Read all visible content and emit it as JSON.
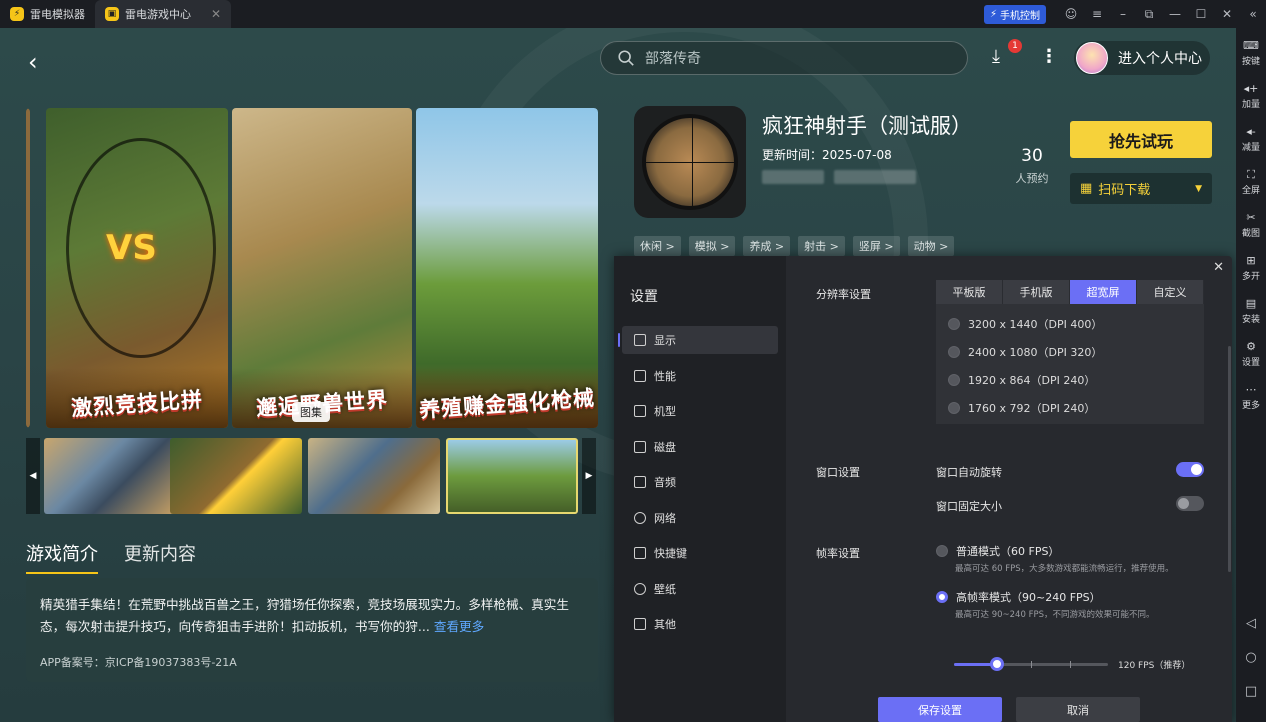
{
  "titlebar": {
    "tabs": [
      {
        "label": "雷电模拟器"
      },
      {
        "label": "雷电游戏中心"
      }
    ],
    "phone_control": "手机控制"
  },
  "header": {
    "search_placeholder": "部落传奇",
    "download_badge": "1",
    "profile_label": "进入个人中心"
  },
  "gallery": {
    "banners": [
      "激烈竞技比拼",
      "邂逅野兽世界",
      "养殖赚金强化枪械"
    ],
    "label": "图集"
  },
  "game": {
    "title": "疯狂神射手（测试服）",
    "update_time": "更新时间：2025-07-08",
    "reserve_count": "30",
    "reserve_label": "人预约",
    "try_button": "抢先试玩",
    "scan_button": "扫码下载",
    "tags": [
      "休闲 >",
      "模拟 >",
      "养成 >",
      "射击 >",
      "竖屏 >",
      "动物 >"
    ]
  },
  "intro": {
    "tabs": [
      "游戏简介",
      "更新内容"
    ],
    "text": "精英猎手集结！在荒野中挑战百兽之王，狩猎场任你探索，竞技场展现实力。多样枪械、真实生态，每次射击提升技巧，向传奇狙击手进阶！扣动扳机，书写你的狩...",
    "see_more": "查看更多",
    "icp": "APP备案号：京ICP备19037383号-21A"
  },
  "settings": {
    "title": "设置",
    "menu": [
      "显示",
      "性能",
      "机型",
      "磁盘",
      "音频",
      "网络",
      "快捷键",
      "壁纸",
      "其他"
    ],
    "resolution_label": "分辨率设置",
    "resolution_tabs": [
      "平板版",
      "手机版",
      "超宽屏",
      "自定义"
    ],
    "resolution_options": [
      "3200 x 1440（DPI 400）",
      "2400 x 1080（DPI 320）",
      "1920 x 864（DPI 240）",
      "1760 x 792（DPI 240）"
    ],
    "window_label": "窗口设置",
    "auto_rotate": "窗口自动旋转",
    "fixed_size": "窗口固定大小",
    "fps_label": "帧率设置",
    "fps_normal": "普通模式（60 FPS）",
    "fps_normal_note": "最高可达 60 FPS，大多数游戏都能流畅运行，推荐使用。",
    "fps_high": "高帧率模式（90~240 FPS）",
    "fps_high_note": "最高可达 90~240 FPS，不同游戏的效果可能不同。",
    "fps_value": "120 FPS（推荐）",
    "fps_slider_fraction": 0.28,
    "save": "保存设置",
    "cancel": "取消"
  },
  "sidebar": {
    "items": [
      "按键",
      "加量",
      "减量",
      "全屏",
      "截图",
      "多开",
      "安装",
      "设置",
      "更多"
    ]
  }
}
